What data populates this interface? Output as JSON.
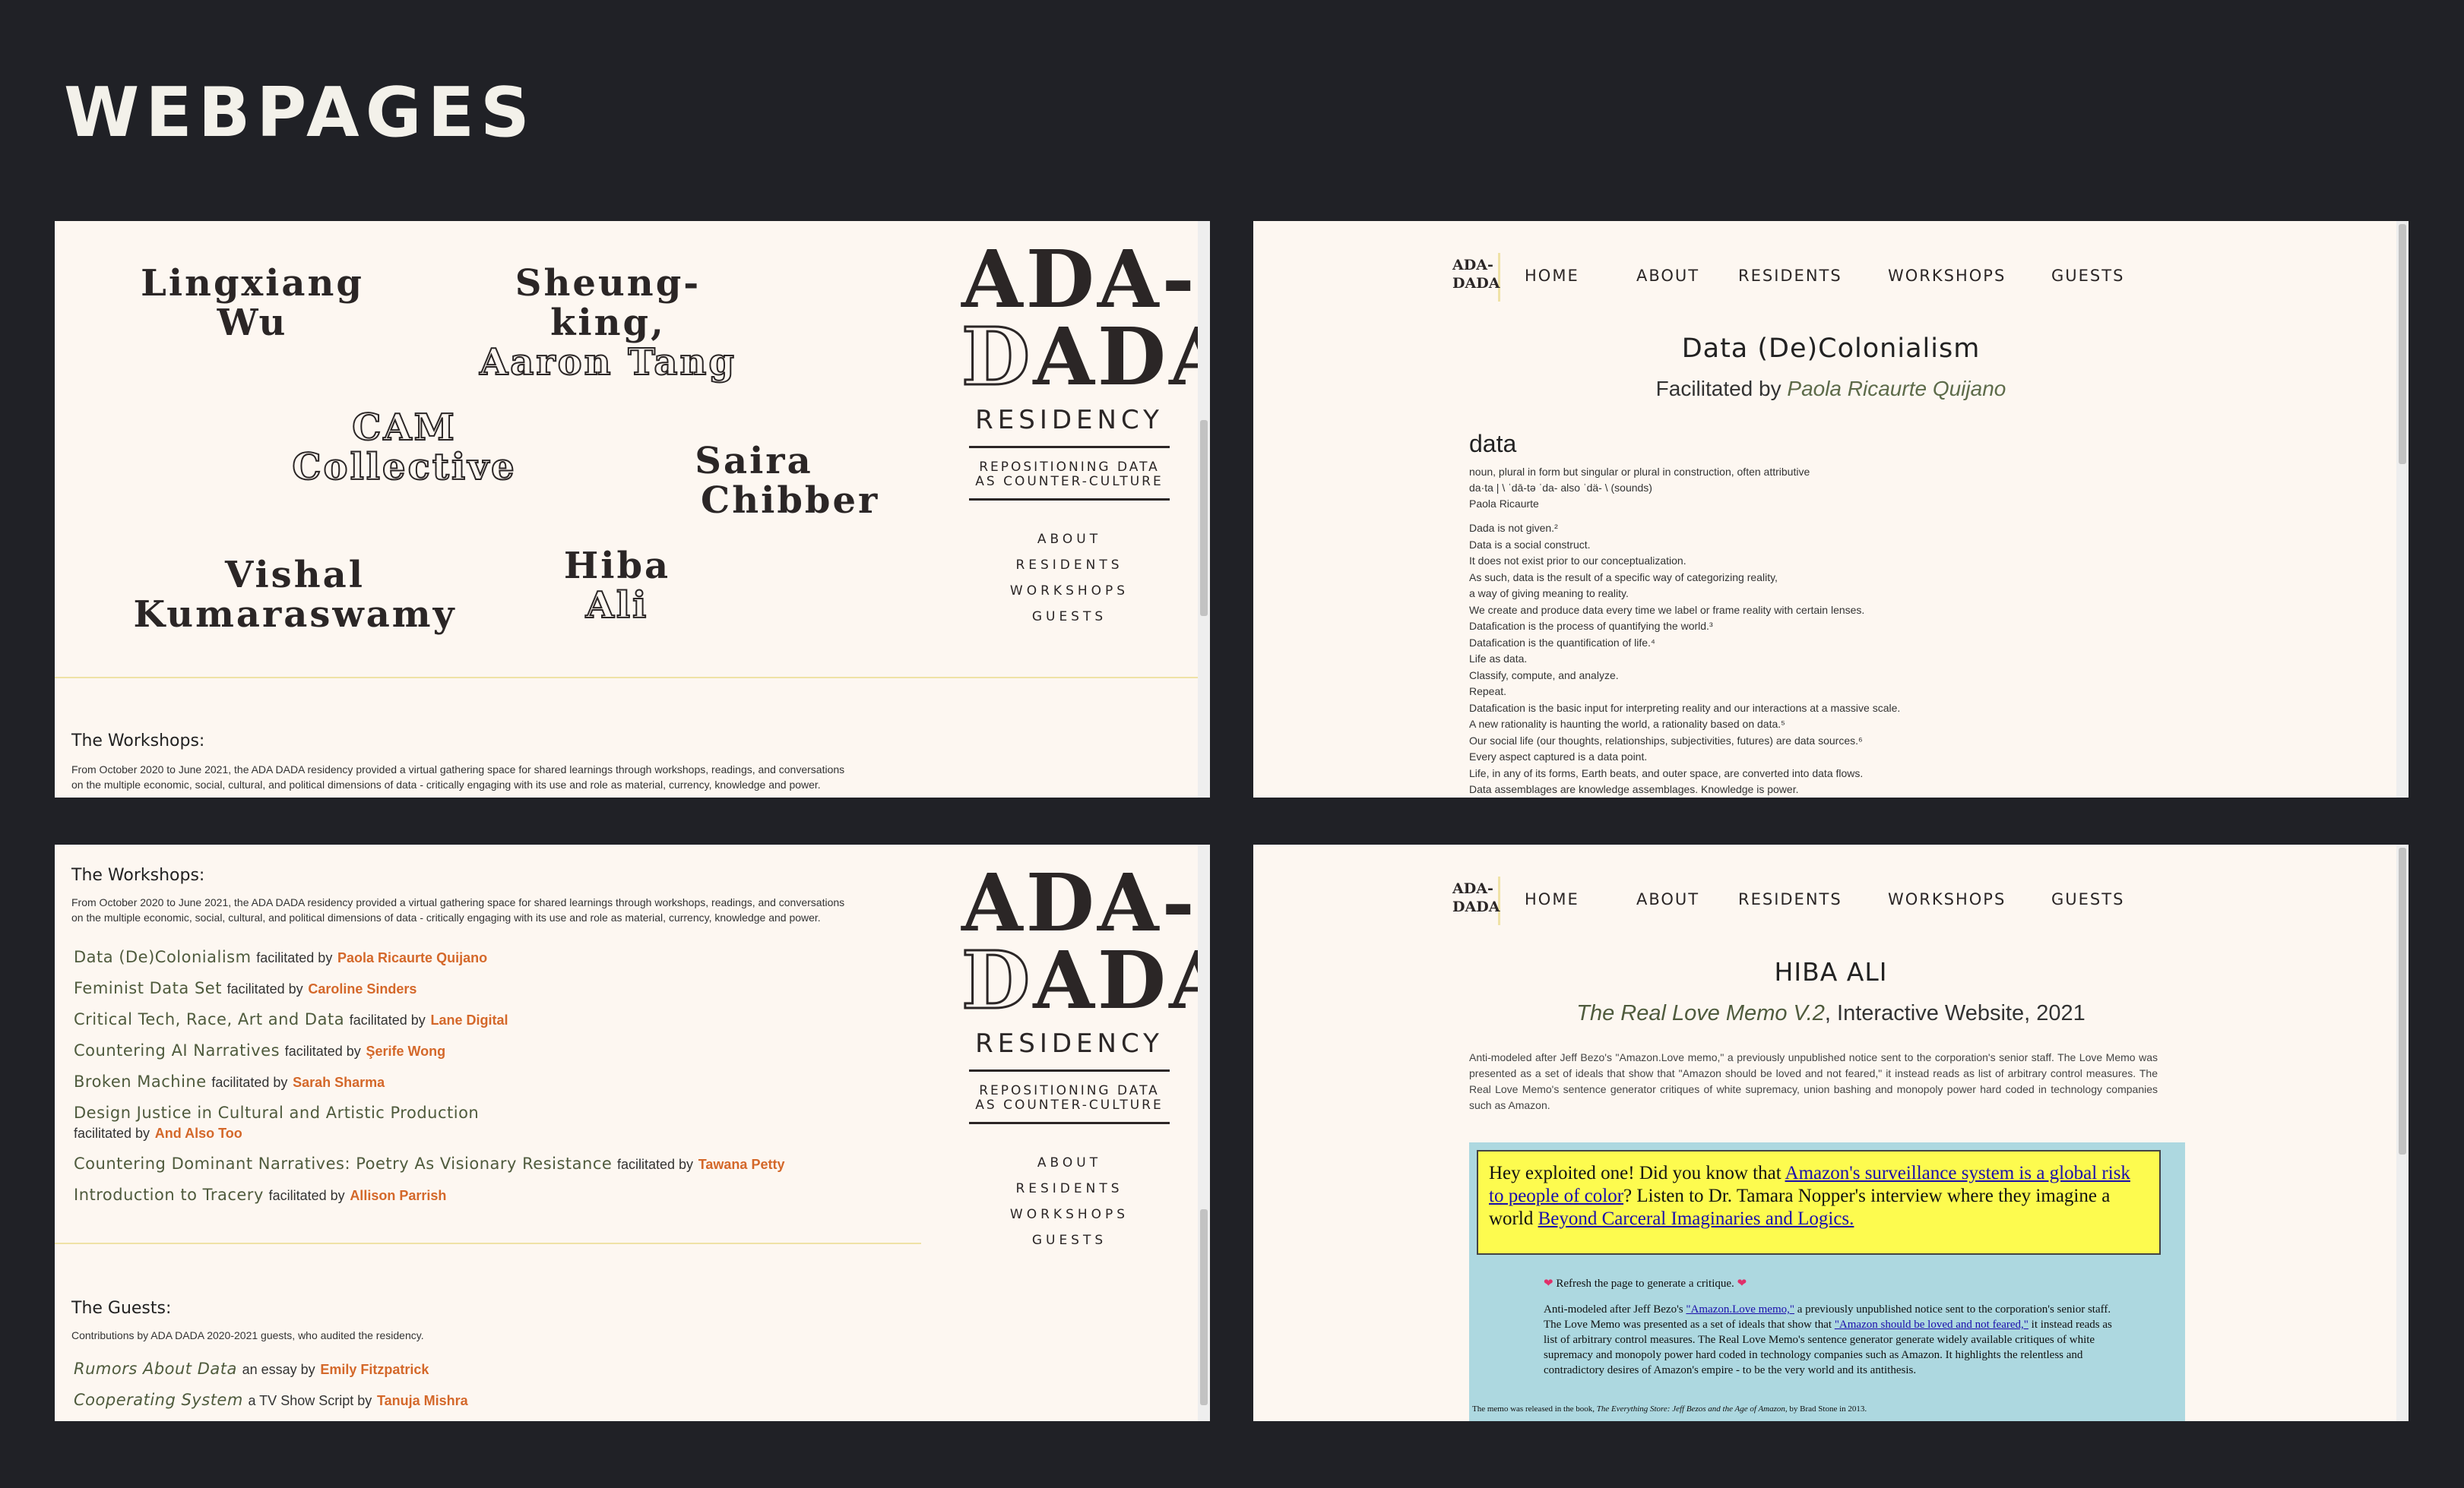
{
  "page": {
    "title": "WEBPAGES"
  },
  "brand": {
    "logo_line1": "ADA-",
    "logo_line2_outline": "D",
    "logo_line2_rest": "ADA",
    "residency": "RESIDENCY",
    "tagline_1": "REPOSITIONING DATA",
    "tagline_2": "AS COUNTER-CULTURE",
    "nav": [
      "ABOUT",
      "RESIDENTS",
      "WORKSHOPS",
      "GUESTS"
    ]
  },
  "residents": [
    {
      "line1": "Lingxiang",
      "line2": "Wu"
    },
    {
      "line1": "Sheung-",
      "line2": "king,",
      "line3": "Aaron Tang"
    },
    {
      "line1": "CAM",
      "line2": "Collective"
    },
    {
      "line1": "Saira",
      "line2": "Chibber"
    },
    {
      "line1": "Vishal",
      "line2": "Kumaraswamy"
    },
    {
      "line1": "Hiba",
      "line2": "Ali"
    }
  ],
  "workshops_section": {
    "heading": "The Workshops:",
    "intro_1": "From October 2020 to June 2021, the ADA DADA residency provided a virtual gathering space for shared learnings through workshops, readings, and conversations",
    "intro_2": "on the multiple economic, social, cultural, and political dimensions of data - critically engaging with its use and role as material, currency, knowledge and power.",
    "facilitated_by": "facilitated by",
    "items": [
      {
        "title": "Data (De)Colonialism",
        "facilitator": "Paola Ricaurte Quijano"
      },
      {
        "title": "Feminist Data Set",
        "facilitator": "Caroline Sinders"
      },
      {
        "title": "Critical Tech, Race, Art and Data",
        "facilitator": "Lane Digital"
      },
      {
        "title": "Countering AI Narratives",
        "facilitator": "Şerife Wong"
      },
      {
        "title": "Broken Machine",
        "facilitator": "Sarah Sharma"
      },
      {
        "title": "Design Justice in Cultural and Artistic Production",
        "facilitator": "And Also Too"
      },
      {
        "title": "Countering Dominant Narratives: Poetry As Visionary Resistance",
        "facilitator": "Tawana Petty"
      },
      {
        "title": "Introduction to Tracery",
        "facilitator": "Allison Parrish"
      }
    ]
  },
  "guests_section": {
    "heading": "The Guests:",
    "intro": "Contributions by ADA DADA 2020-2021 guests, who audited the residency.",
    "items": [
      {
        "title": "Rumors About Data",
        "kind": "an essay by",
        "author": "Emily Fitzpatrick"
      },
      {
        "title": "Cooperating System",
        "kind": "a TV Show Script by",
        "author": "Tanuja Mishra"
      }
    ]
  },
  "topnav": {
    "logo_1": "ADA-",
    "logo_2": "DADA",
    "items": [
      "HOME",
      "ABOUT",
      "RESIDENTS",
      "WORKSHOPS",
      "GUESTS"
    ]
  },
  "workshop_page": {
    "title": "Data (De)Colonialism",
    "facilitated_prefix": "Facilitated by",
    "facilitator": "Paola Ricaurte Quijano",
    "word": "data",
    "meta": [
      "noun, plural in form but singular or plural in construction, often attributive",
      "da·ta | \\ ˈdā-tə  ˈda-  also ˈdä- \\ (sounds)",
      "Paola Ricaurte"
    ],
    "lines": [
      "Dada is not given.²",
      "Data is a social construct.",
      "It does not exist prior to our conceptualization.",
      "As such, data is the result of a specific way of categorizing reality,",
      "a way of giving meaning to reality.",
      "We create and produce data every time we label or frame reality with certain lenses.",
      "Datafication is the process of quantifying the world.³",
      "Datafication is the quantification of life.⁴",
      "Life as data.",
      "Classify, compute, and analyze.",
      "Repeat.",
      "Datafication is the basic input for interpreting reality and our interactions at a massive scale.",
      "A new rationality is haunting the world, a rationality based on data.⁵",
      "Our social life (our thoughts, relationships, subjectivities, futures) are data sources.⁶",
      "Every aspect captured is a data point.",
      "Life, in any of its forms, Earth beats, and outer space, are converted into data flows.",
      "Data assemblages are knowledge assemblages. Knowledge is power."
    ]
  },
  "artist_page": {
    "name": "HIBA ALI",
    "work_title": "The Real Love Memo V.2",
    "work_rest": ", Interactive Website, 2021",
    "description": "Anti-modeled after Jeff Bezo's \"Amazon.Love memo,\" a previously unpublished notice sent to the corporation's senior staff. The Love Memo was presented as a set of ideals that show that \"Amazon should be loved and not feared,\" it instead reads as list of arbitrary control measures. The Real Love Memo's sentence generator critiques of white supremacy, union bashing and monopoly power hard coded in technology companies such as Amazon.",
    "banner_1": "Hey exploited one! Did you know that ",
    "banner_link_1": "Amazon's surveillance system is a global risk to people of color",
    "banner_2": "? Listen to Dr. Tamara Nopper's interview where they imagine a world ",
    "banner_link_2": "Beyond Carceral Imaginaries and Logics.",
    "refresh": "Refresh the page to generate a critique.",
    "critique_1": "Anti-modeled after Jeff Bezo's ",
    "critique_link_1": "\"Amazon.Love memo,\"",
    "critique_2": " a previously unpublished notice sent to the corporation's senior staff. The Love Memo was presented as a set of ideals that show that ",
    "critique_link_2": "\"Amazon should be loved and not feared,\"",
    "critique_3": " it instead reads as list of arbitrary control measures. The Real Love Memo's sentence generator generate widely available critiques of white supremacy and monopoly power hard coded in technology companies such as Amazon. It highlights the relentless and contradictory desires of Amazon's empire - to be the very world and its antithesis.",
    "footnote_1": "The memo was released in the book, ",
    "footnote_book": "The Everything Store: Jeff Bezos and the Age of Amazon",
    "footnote_2": ", by Brad Stone in 2013."
  },
  "colors": {
    "background": "#202126",
    "panel": "#fdf7f1",
    "accent_orange": "#d4682a",
    "accent_green": "#4f5b3d",
    "banner_yellow": "#fdfb4f",
    "embed_blue": "#add8e0"
  }
}
